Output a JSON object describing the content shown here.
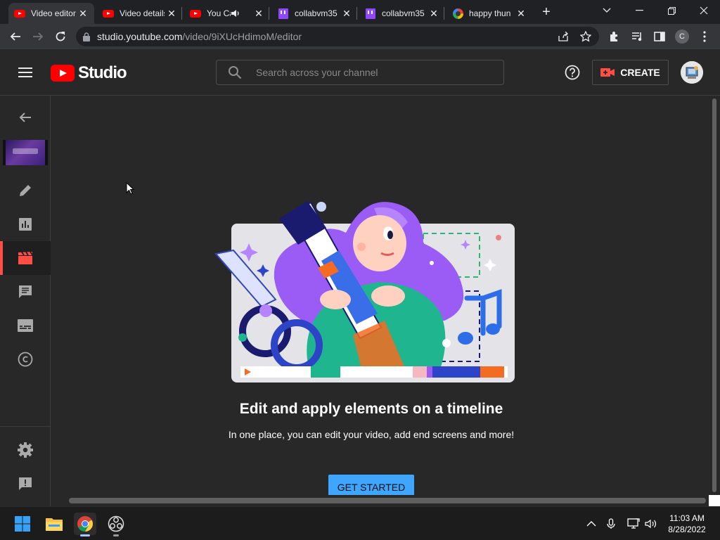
{
  "browser": {
    "tabs": [
      {
        "title": "Video editor",
        "icon": "youtube-icon",
        "active": true
      },
      {
        "title": "Video details",
        "icon": "youtube-icon",
        "active": false
      },
      {
        "title": "You Can",
        "icon": "youtube-icon",
        "active": false,
        "audio": true
      },
      {
        "title": "collabvm35",
        "icon": "twitch-icon",
        "active": false
      },
      {
        "title": "collabvm35",
        "icon": "twitch-icon",
        "active": false
      },
      {
        "title": "happy thun",
        "icon": "google-icon",
        "active": false
      }
    ],
    "url_host": "studio.youtube.com",
    "url_path": "/video/9iXUcHdimoM/editor",
    "profile_initial": "C"
  },
  "studio": {
    "logo_text": "Studio",
    "search_placeholder": "Search across your channel",
    "create_label": "CREATE"
  },
  "sidebar": {
    "items": [
      {
        "name": "back",
        "icon": "back-arrow-icon"
      },
      {
        "name": "details",
        "icon": "pencil-icon"
      },
      {
        "name": "analytics",
        "icon": "analytics-icon"
      },
      {
        "name": "editor",
        "icon": "clapperboard-icon",
        "active": true
      },
      {
        "name": "comments",
        "icon": "comments-icon"
      },
      {
        "name": "subtitles",
        "icon": "subtitles-icon"
      },
      {
        "name": "copyright",
        "icon": "copyright-icon"
      },
      {
        "name": "settings",
        "icon": "gear-icon"
      },
      {
        "name": "feedback",
        "icon": "feedback-icon"
      }
    ]
  },
  "main": {
    "headline": "Edit and apply elements on a timeline",
    "subtext": "In one place, you can edit your video, add end screens and more!",
    "cta_label": "GET STARTED"
  },
  "taskbar": {
    "time": "11:03 AM",
    "date": "8/28/2022"
  },
  "colors": {
    "accent_red": "#ff4e45",
    "cta_blue": "#3ea6ff",
    "bg_dark": "#282828"
  }
}
